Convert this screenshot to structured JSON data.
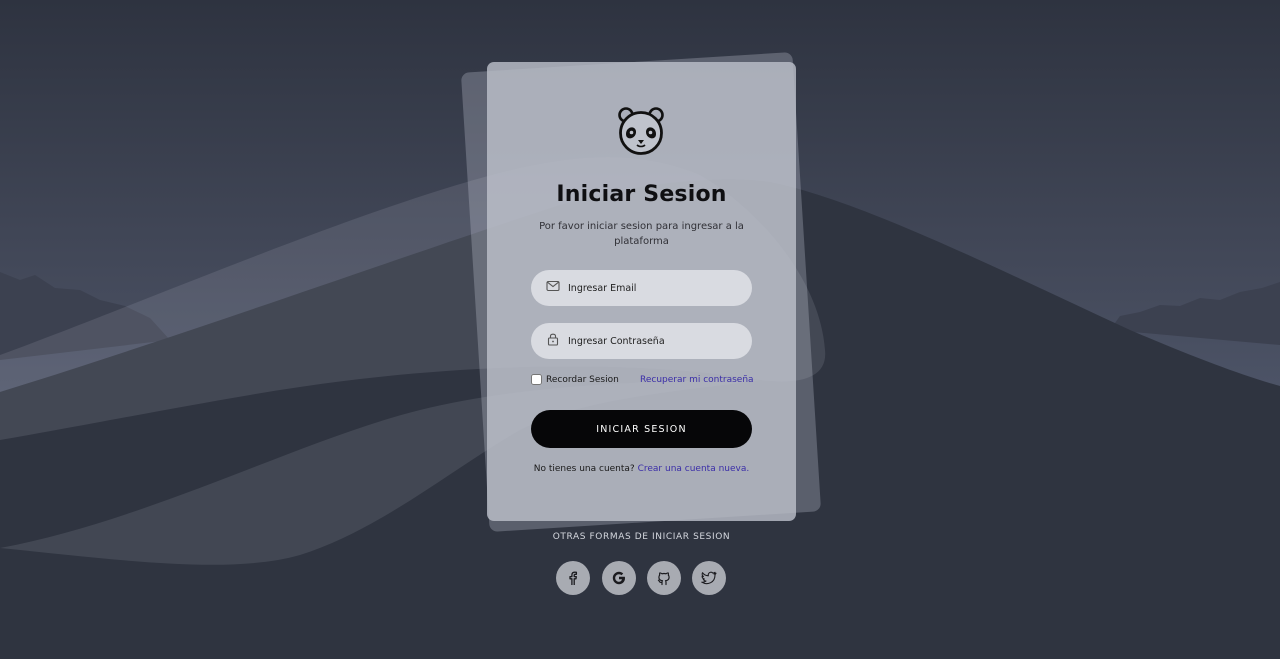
{
  "login": {
    "title": "Iniciar Sesion",
    "subtitle": "Por favor iniciar sesion para ingresar a la plataforma",
    "email_placeholder": "Ingresar Email",
    "password_placeholder": "Ingresar Contraseña",
    "remember_label": "Recordar Sesion",
    "forgot_link": "Recuperar mi contraseña",
    "submit_label": "INICIAR SESION",
    "register_prompt": "No tienes una cuenta?",
    "register_link": "Crear una cuenta nueva."
  },
  "social": {
    "title": "OTRAS FORMAS DE INICIAR SESION",
    "providers": [
      {
        "name": "facebook",
        "icon": "facebook-icon"
      },
      {
        "name": "google",
        "icon": "google-icon"
      },
      {
        "name": "github",
        "icon": "github-icon"
      },
      {
        "name": "twitter",
        "icon": "twitter-icon"
      }
    ]
  },
  "colors": {
    "background": "#2f3440",
    "card": "#bec2cc",
    "button": "#060608",
    "link": "#3b2ea8",
    "social_button": "#a8abb2"
  }
}
